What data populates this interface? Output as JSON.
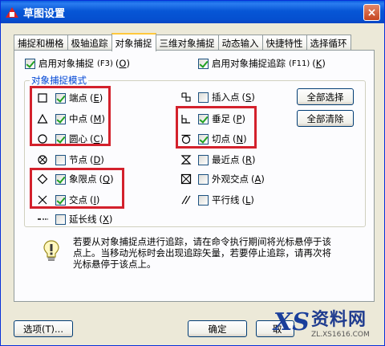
{
  "window": {
    "title": "草图设置",
    "close": "×"
  },
  "tabs": [
    "捕捉和栅格",
    "极轴追踪",
    "对象捕捉",
    "三维对象捕捉",
    "动态输入",
    "快捷特性",
    "选择循环"
  ],
  "enable_osnap": {
    "label": "启用对象捕捉",
    "shortcut": "(F3)",
    "key": "O",
    "checked": true
  },
  "enable_tracking": {
    "label": "启用对象捕捉追踪",
    "shortcut": "(F11)",
    "key": "K",
    "checked": true
  },
  "group_title": "对象捕捉模式",
  "modes_left": [
    {
      "label": "端点",
      "key": "E",
      "checked": true,
      "icon": "endpoint-square-icon"
    },
    {
      "label": "中点",
      "key": "M",
      "checked": true,
      "icon": "midpoint-triangle-icon"
    },
    {
      "label": "圆心",
      "key": "C",
      "checked": true,
      "icon": "center-circle-icon"
    },
    {
      "label": "节点",
      "key": "D",
      "checked": false,
      "icon": "node-circle-x-icon"
    },
    {
      "label": "象限点",
      "key": "Q",
      "checked": true,
      "icon": "quadrant-diamond-icon"
    },
    {
      "label": "交点",
      "key": "I",
      "checked": true,
      "icon": "intersection-x-icon"
    },
    {
      "label": "延长线",
      "key": "X",
      "checked": false,
      "icon": "extension-dots-icon"
    }
  ],
  "modes_right": [
    {
      "label": "插入点",
      "key": "S",
      "checked": false,
      "icon": "insertion-icon"
    },
    {
      "label": "垂足",
      "key": "P",
      "checked": true,
      "icon": "perpendicular-icon"
    },
    {
      "label": "切点",
      "key": "N",
      "checked": true,
      "icon": "tangent-icon"
    },
    {
      "label": "最近点",
      "key": "R",
      "checked": false,
      "icon": "nearest-hourglass-icon"
    },
    {
      "label": "外观交点",
      "key": "A",
      "checked": false,
      "icon": "apparent-intersection-icon"
    },
    {
      "label": "平行线",
      "key": "L",
      "checked": false,
      "icon": "parallel-icon"
    }
  ],
  "buttons": {
    "select_all": "全部选择",
    "clear_all": "全部清除",
    "options": "选项(T)...",
    "ok": "确定",
    "cancel": "取"
  },
  "info_text": "若要从对象捕捉点进行追踪，请在命令执行期间将光标悬停于该点上。当移动光标时会出现追踪矢量，若要停止追踪，请再次将光标悬停于该点上。",
  "watermark": {
    "cn": "资料网",
    "url": "ZL.XS1616.COM"
  }
}
